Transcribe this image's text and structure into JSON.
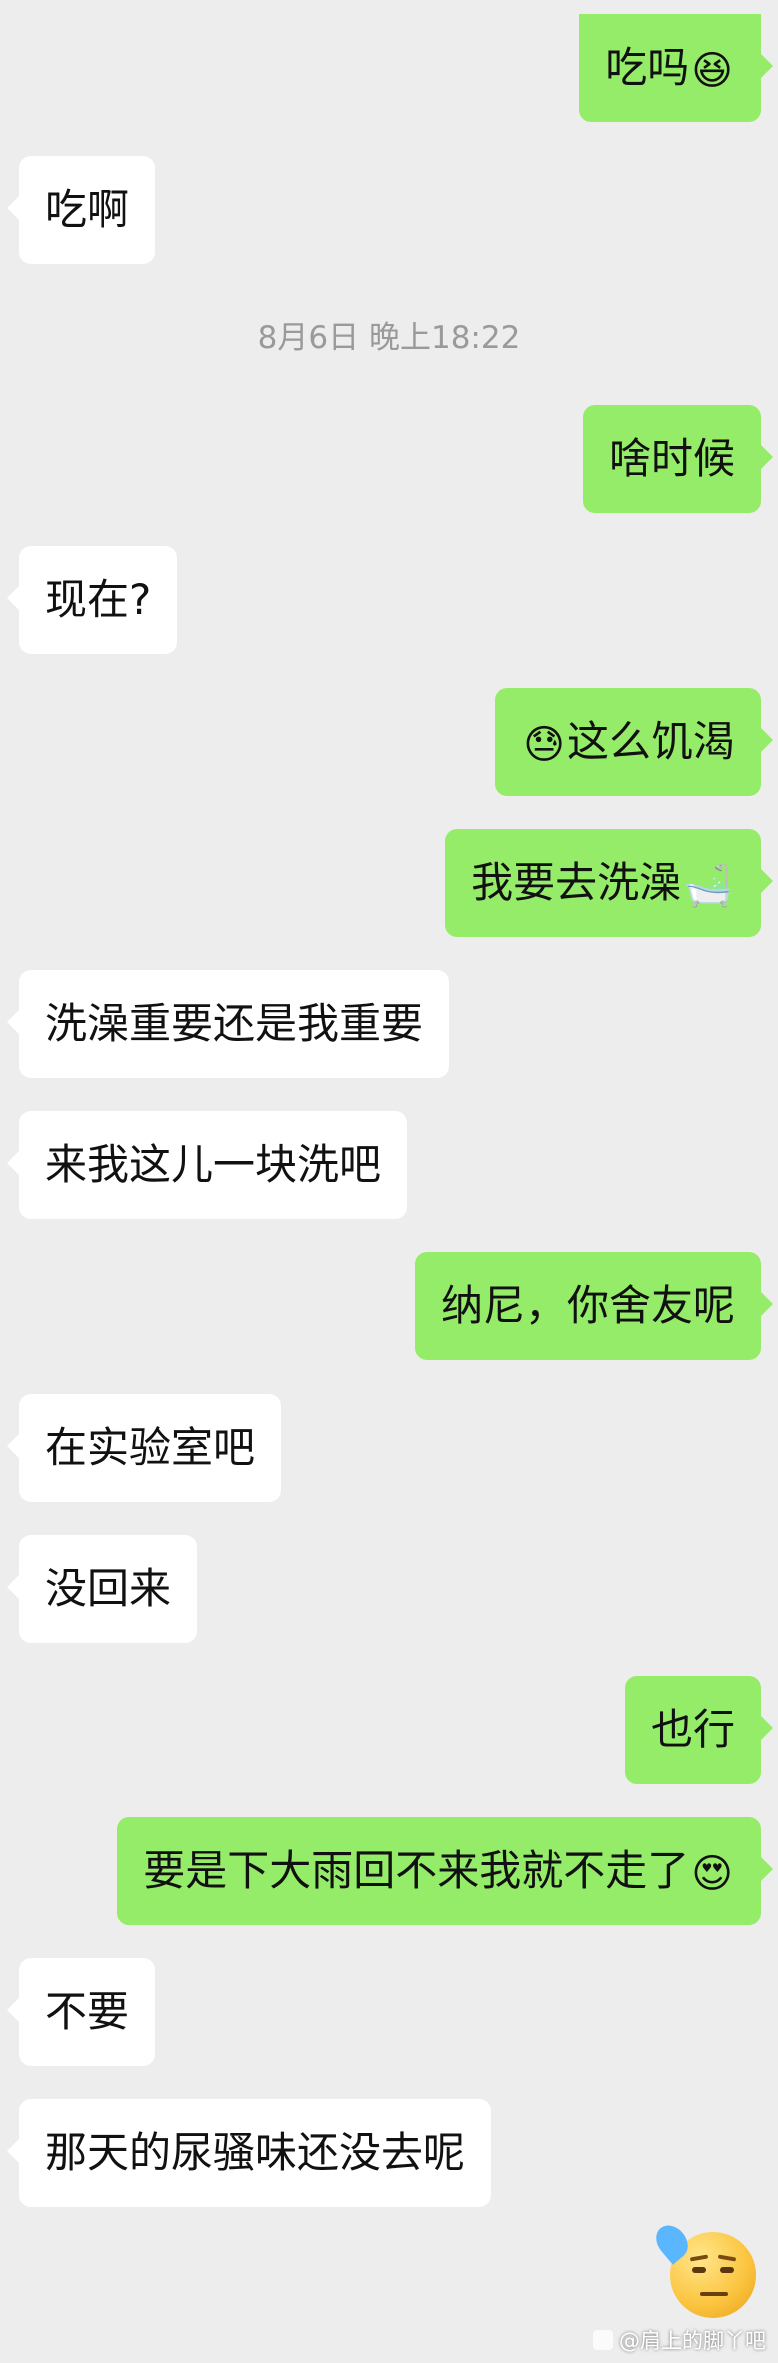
{
  "messages": [
    {
      "side": "out",
      "text": "吃吗",
      "emoji": "😆",
      "emoji_pos": "after"
    },
    {
      "side": "in",
      "text": "吃啊"
    },
    {
      "side": "out",
      "text": "啥时候"
    },
    {
      "side": "in",
      "text": "现在?"
    },
    {
      "side": "out",
      "text": "这么饥渴",
      "emoji": "😓",
      "emoji_pos": "before"
    },
    {
      "side": "out",
      "text": "我要去洗澡",
      "emoji": "🛁",
      "emoji_pos": "after"
    },
    {
      "side": "in",
      "text": "洗澡重要还是我重要"
    },
    {
      "side": "in",
      "text": "来我这儿一块洗吧"
    },
    {
      "side": "out",
      "text": "纳尼，你舍友呢"
    },
    {
      "side": "in",
      "text": "在实验室吧"
    },
    {
      "side": "in",
      "text": "没回来"
    },
    {
      "side": "out",
      "text": "也行"
    },
    {
      "side": "out",
      "text": "要是下大雨回不来我就不走了",
      "emoji": "😍",
      "emoji_pos": "after"
    },
    {
      "side": "in",
      "text": "不要"
    },
    {
      "side": "in",
      "text": "那天的尿骚味还没去呢"
    }
  ],
  "timestamp": "8月6日 晚上18:22",
  "sticker": {
    "icon": "sweat-smirk-emoji"
  },
  "watermark": {
    "text": "@肩上的脚丫吧"
  },
  "colors": {
    "background": "#ededed",
    "outgoing_bubble": "#95ec69",
    "incoming_bubble": "#ffffff",
    "timestamp_text": "#9a9a9a"
  }
}
